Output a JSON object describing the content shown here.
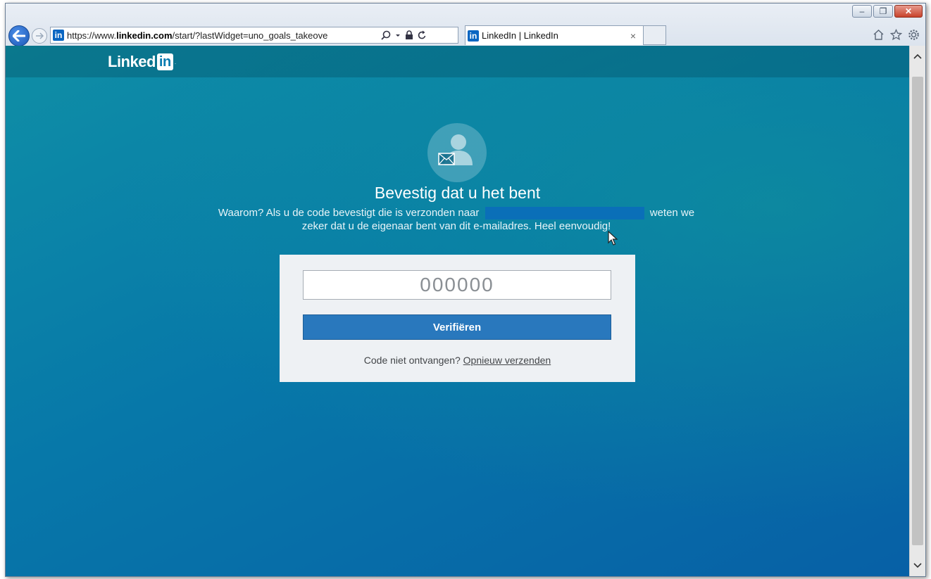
{
  "browser": {
    "url_prefix": "https://www.",
    "url_domain": "linkedin.com",
    "url_path": "/start/?lastWidget=uno_goals_takeove",
    "tab_title": "LinkedIn | LinkedIn",
    "tab_close": "×",
    "favicon_text": "in"
  },
  "window_controls": {
    "minimize": "–",
    "restore": "❐",
    "close": "✕"
  },
  "toolbar_icons": {
    "home": "home-icon",
    "favorites": "star-icon",
    "settings": "gear-icon"
  },
  "header": {
    "logo_text": "Linked",
    "logo_in": "in",
    "logo_dot": "."
  },
  "main": {
    "heading": "Bevestig dat u het bent",
    "sub_line1_before": "Waarom? Als u de code bevestigt die is verzonden naar",
    "sub_line1_after": "weten we",
    "sub_line2": "zeker dat u de eigenaar bent van dit e-mailadres. Heel eenvoudig!"
  },
  "form": {
    "code_placeholder": "000000",
    "verify_label": "Verifiëren",
    "resend_prefix": "Code niet ontvangen?",
    "resend_link": "Opnieuw verzenden"
  },
  "colors": {
    "linkedin_blue": "#0a66c2",
    "button_blue": "#2978bd",
    "page_teal": "#0f8fa6",
    "page_blue": "#0760a6"
  }
}
